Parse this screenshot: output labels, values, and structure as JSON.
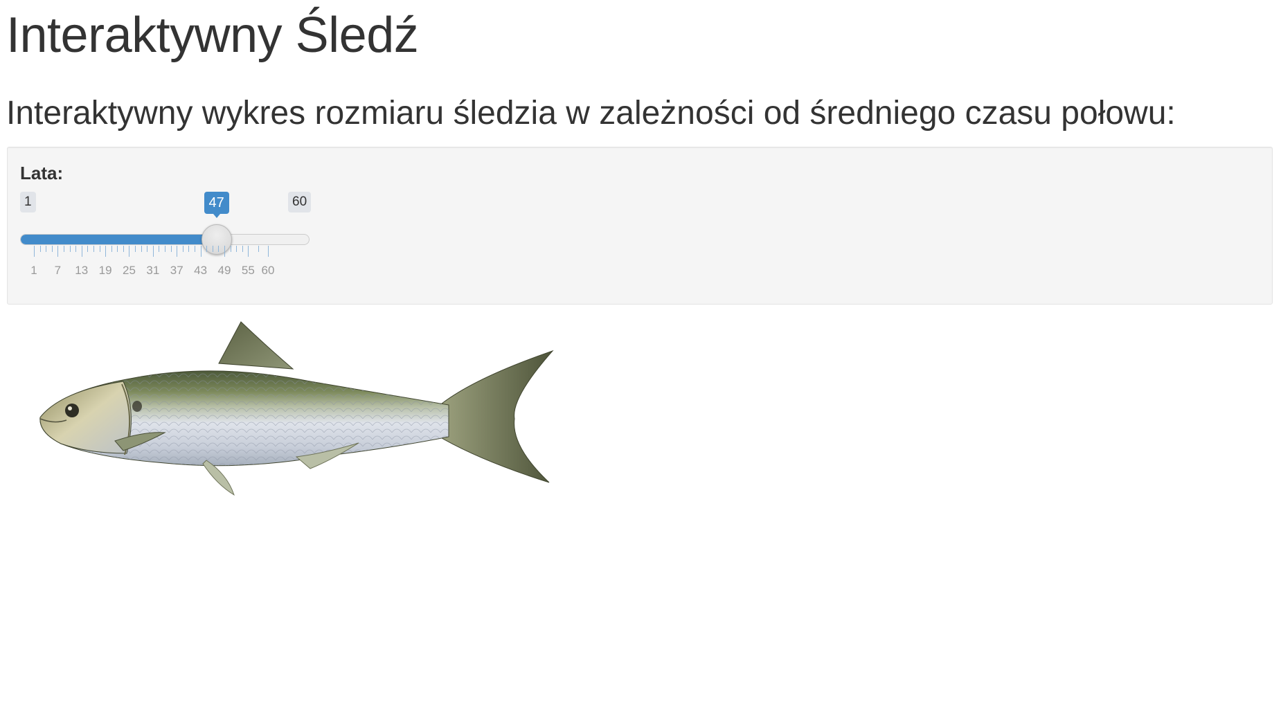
{
  "page": {
    "title": "Interaktywny Śledź",
    "subtitle": "Interaktywny wykres rozmiaru śledzia w zależności od średniego czasu połowu:"
  },
  "slider": {
    "label": "Lata:",
    "min": 1,
    "max": 60,
    "value": 47,
    "min_label": "1",
    "max_label": "60",
    "value_label": "47",
    "grid_labels": [
      "1",
      "7",
      "13",
      "19",
      "25",
      "31",
      "37",
      "43",
      "49",
      "55",
      "60"
    ],
    "accent_color": "#428bca"
  },
  "image": {
    "subject": "herring-fish-illustration"
  }
}
